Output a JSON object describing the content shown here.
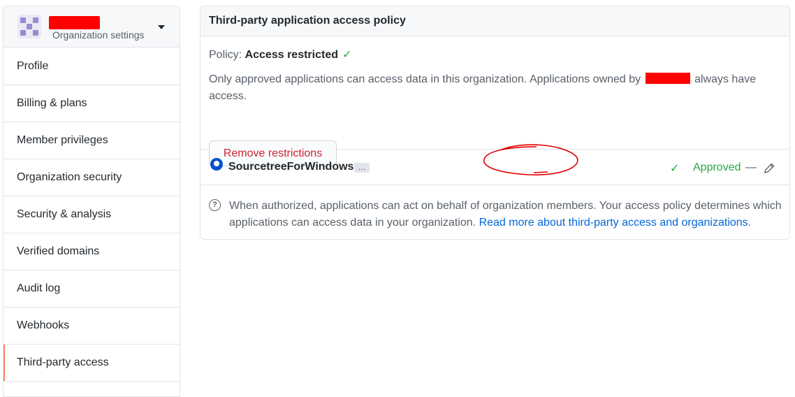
{
  "sidebar": {
    "org_subtitle": "Organization settings",
    "items": [
      {
        "label": "Profile"
      },
      {
        "label": "Billing & plans"
      },
      {
        "label": "Member privileges"
      },
      {
        "label": "Organization security"
      },
      {
        "label": "Security & analysis"
      },
      {
        "label": "Verified domains"
      },
      {
        "label": "Audit log"
      },
      {
        "label": "Webhooks"
      },
      {
        "label": "Third-party access",
        "active": true
      }
    ]
  },
  "main": {
    "header_title": "Third-party application access policy",
    "policy_prefix": "Policy:",
    "policy_value": "Access restricted",
    "description_start": "Only approved applications can access data in this organization. Applications owned by",
    "description_end": "always have access.",
    "remove_button_label": "Remove restrictions",
    "app": {
      "name": "SourcetreeForWindows",
      "more_label": "…",
      "status": "Approved",
      "dash": "—"
    },
    "info_text": "When authorized, applications can act on behalf of organization members. Your access policy determines which applications can access data in your organization.",
    "info_link": "Read more about third-party access and organizations",
    "info_period": "."
  },
  "colors": {
    "accent_active": "#f9826c",
    "success": "#28a745",
    "danger": "#cb2431",
    "link": "#0366d6"
  },
  "icons": [
    "org-avatar-icon",
    "caret-down-icon",
    "check-icon",
    "app-icon",
    "pencil-icon",
    "question-icon"
  ]
}
